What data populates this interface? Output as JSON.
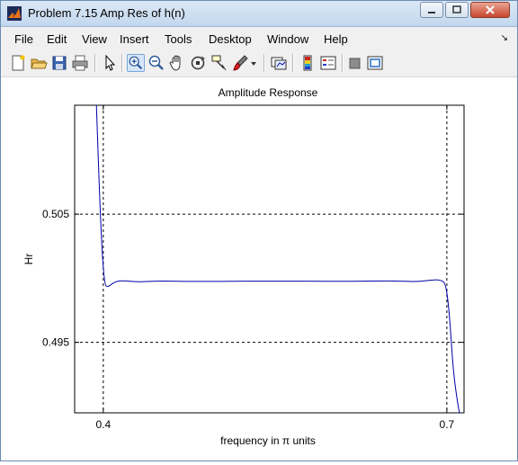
{
  "window": {
    "title": "Problem 7.15 Amp Res of h(n)",
    "controls": [
      "minimize",
      "maximize",
      "close"
    ]
  },
  "menubar": {
    "items": [
      "File",
      "Edit",
      "View",
      "Insert",
      "Tools",
      "Desktop",
      "Window",
      "Help"
    ],
    "overflow_glyph": "↘"
  },
  "toolbar": {
    "buttons": [
      {
        "name": "new-figure-icon"
      },
      {
        "name": "open-file-icon"
      },
      {
        "name": "save-figure-icon"
      },
      {
        "name": "print-figure-icon"
      },
      {
        "name": "edit-plot-arrow-icon"
      },
      {
        "name": "zoom-in-icon",
        "active": true
      },
      {
        "name": "zoom-out-icon"
      },
      {
        "name": "pan-hand-icon"
      },
      {
        "name": "rotate-3d-icon"
      },
      {
        "name": "data-cursor-icon"
      },
      {
        "name": "brush-icon"
      },
      {
        "name": "brush-dropdown-icon"
      },
      {
        "name": "link-plot-icon"
      },
      {
        "name": "insert-colorbar-icon"
      },
      {
        "name": "insert-legend-icon"
      },
      {
        "name": "hide-plot-tools-icon"
      },
      {
        "name": "show-plot-tools-icon"
      }
    ]
  },
  "chart_data": {
    "type": "line",
    "title": "Amplitude Response",
    "xlabel": "frequency in π units",
    "ylabel": "Hr",
    "xlim": [
      0.375,
      0.715
    ],
    "ylim": [
      0.4895,
      0.5135
    ],
    "xticks": [
      0.4,
      0.7
    ],
    "xtick_labels": [
      "0.4",
      "0.7"
    ],
    "yticks": [
      0.495,
      0.505
    ],
    "ytick_labels": [
      "0.495",
      "0.505"
    ],
    "grid": "dashed lines at tick positions",
    "line_color": "#0000aa",
    "series": [
      {
        "x": [
          0.394,
          0.398,
          0.401,
          0.404,
          0.408,
          0.413,
          0.42,
          0.43,
          0.45,
          0.47,
          0.5,
          0.52,
          0.55,
          0.58,
          0.61,
          0.64,
          0.66,
          0.675,
          0.69,
          0.695,
          0.699,
          0.702,
          0.705,
          0.707,
          0.709,
          0.711
        ],
        "y": [
          0.5135,
          0.5035,
          0.4995,
          0.4993,
          0.4996,
          0.4998,
          0.4998,
          0.4997,
          0.4998,
          0.49975,
          0.49975,
          0.49978,
          0.49977,
          0.49978,
          0.49976,
          0.49979,
          0.49978,
          0.49973,
          0.4999,
          0.49985,
          0.4996,
          0.4975,
          0.4935,
          0.4918,
          0.4905,
          0.4895
        ]
      }
    ]
  }
}
